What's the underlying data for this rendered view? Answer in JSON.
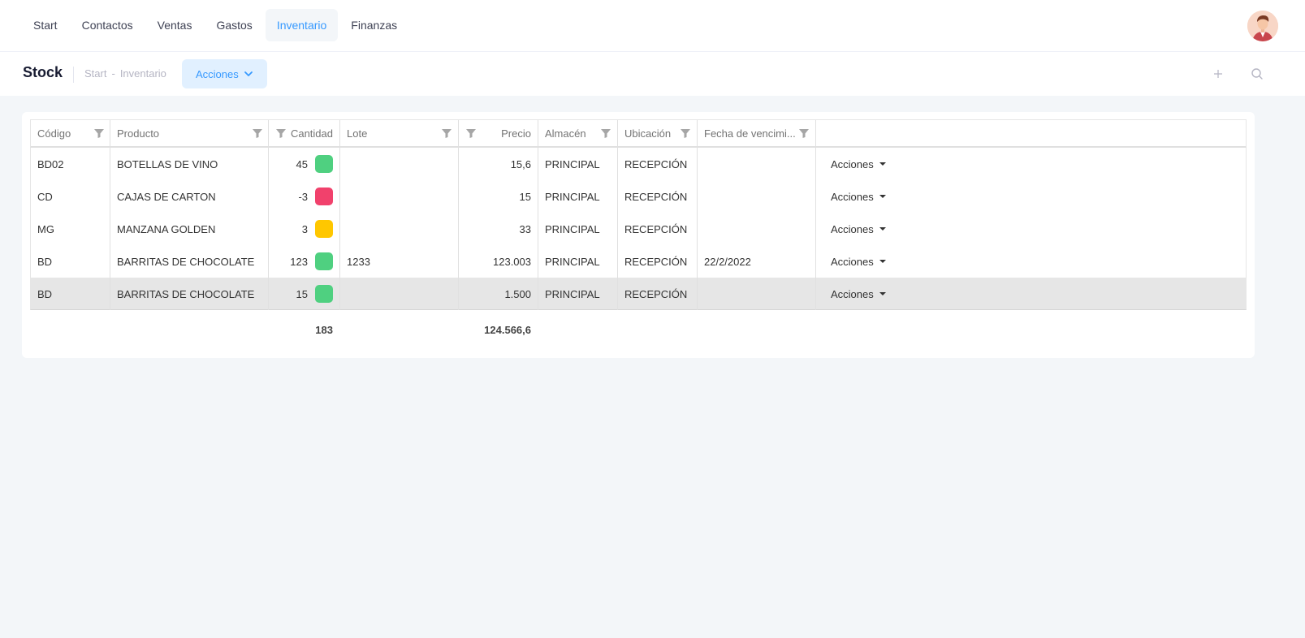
{
  "nav": {
    "items": [
      {
        "label": "Start",
        "active": false
      },
      {
        "label": "Contactos",
        "active": false
      },
      {
        "label": "Ventas",
        "active": false
      },
      {
        "label": "Gastos",
        "active": false
      },
      {
        "label": "Inventario",
        "active": true
      },
      {
        "label": "Finanzas",
        "active": false
      }
    ]
  },
  "subheader": {
    "title": "Stock",
    "breadcrumb": [
      "Start",
      "Inventario"
    ],
    "breadcrumb_sep": "-",
    "actions_label": "Acciones"
  },
  "table": {
    "columns": [
      {
        "label": "Código"
      },
      {
        "label": "Producto"
      },
      {
        "label": "Cantidad"
      },
      {
        "label": "Lote"
      },
      {
        "label": "Precio"
      },
      {
        "label": "Almacén"
      },
      {
        "label": "Ubicación"
      },
      {
        "label": "Fecha de vencimi..."
      },
      {
        "label": ""
      }
    ],
    "rows": [
      {
        "codigo": "BD02",
        "producto": "BOTELLAS DE VINO",
        "cantidad": "45",
        "status_color": "#4fd080",
        "lote": "",
        "precio": "15,6",
        "almacen": "PRINCIPAL",
        "ubicacion": "RECEPCIÓN",
        "fecha": "",
        "accion": "Acciones",
        "selected": false
      },
      {
        "codigo": "CD",
        "producto": "CAJAS DE CARTON",
        "cantidad": "-3",
        "status_color": "#f1416c",
        "lote": "",
        "precio": "15",
        "almacen": "PRINCIPAL",
        "ubicacion": "RECEPCIÓN",
        "fecha": "",
        "accion": "Acciones",
        "selected": false
      },
      {
        "codigo": "MG",
        "producto": "MANZANA GOLDEN",
        "cantidad": "3",
        "status_color": "#ffc700",
        "lote": "",
        "precio": "33",
        "almacen": "PRINCIPAL",
        "ubicacion": "RECEPCIÓN",
        "fecha": "",
        "accion": "Acciones",
        "selected": false
      },
      {
        "codigo": "BD",
        "producto": "BARRITAS DE CHOCOLATE",
        "cantidad": "123",
        "status_color": "#4fd080",
        "lote": "1233",
        "precio": "123.003",
        "almacen": "PRINCIPAL",
        "ubicacion": "RECEPCIÓN",
        "fecha": "22/2/2022",
        "accion": "Acciones",
        "selected": false
      },
      {
        "codigo": "BD",
        "producto": "BARRITAS DE CHOCOLATE",
        "cantidad": "15",
        "status_color": "#4fd080",
        "lote": "",
        "precio": "1.500",
        "almacen": "PRINCIPAL",
        "ubicacion": "RECEPCIÓN",
        "fecha": "",
        "accion": "Acciones",
        "selected": true
      }
    ],
    "totals": {
      "cantidad": "183",
      "precio": "124.566,6"
    }
  },
  "colors": {
    "accent": "#3699ff",
    "accent_light": "#e1f0ff",
    "background": "#f3f6f9"
  }
}
